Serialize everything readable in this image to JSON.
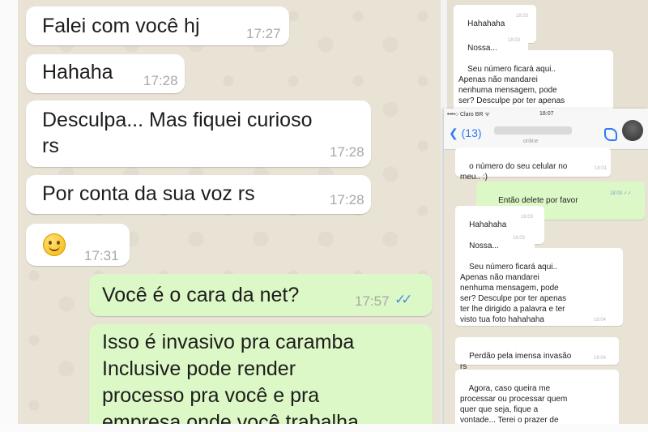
{
  "left_chat": {
    "messages": [
      {
        "dir": "in",
        "text": "Falei com você hj",
        "time": "17:27"
      },
      {
        "dir": "in",
        "text": "Hahaha",
        "time": "17:28"
      },
      {
        "dir": "in",
        "text": "Desculpa... Mas fiquei curioso\nrs",
        "time": "17:28"
      },
      {
        "dir": "in",
        "text": "Por conta da sua voz rs",
        "time": "17:28"
      },
      {
        "dir": "in",
        "emoji": "smiling-emoji",
        "time": "17:31"
      },
      {
        "dir": "out",
        "text": "Você é o cara da net?",
        "time": "17:57",
        "ticks": "✓✓"
      },
      {
        "dir": "out",
        "text": "Isso é invasivo pra caramba\nInclusive pode render\nprocesso pra você e pra\nempresa onde você trabalha"
      }
    ]
  },
  "right_back": {
    "messages": [
      {
        "text": "Hahahaha",
        "time": "18:03"
      },
      {
        "text": "Nossa...",
        "time": "18:03"
      },
      {
        "text": "Seu número ficará aqui..\nApenas não mandarei\nnenhuma mensagem, pode\nser? Desculpe por ter apenas"
      }
    ]
  },
  "right_front": {
    "status_bar": {
      "carrier": "••••○ Claro BR ᯤ",
      "time": "18:07"
    },
    "header": {
      "back_label": "❮ (13)",
      "online": "online"
    },
    "messages": [
      {
        "dir": "in",
        "text": "o número do seu celular no\nmeu.. :)",
        "time": "18:01"
      },
      {
        "dir": "out",
        "text": "Então delete por favor",
        "time": "18:03 ✓✓"
      },
      {
        "dir": "in",
        "text": "Hahahaha",
        "time": "18:03"
      },
      {
        "dir": "in",
        "text": "Nossa...",
        "time": "18:03"
      },
      {
        "dir": "in",
        "text": "Seu número ficará aqui..\nApenas não mandarei\nnenhuma mensagem, pode\nser? Desculpe por ter apenas\nter lhe dirigido a palavra e ter\nvisto tua foto hahahaha",
        "time": "18:04"
      },
      {
        "dir": "in",
        "text": "Perdão pela imensa invasão\nrs",
        "time": "18:04"
      },
      {
        "dir": "in",
        "text": "Agora, caso queira me\nprocessar ou processar quem\nquer que seja, fique a\nvontade... Terei o prazer de"
      }
    ]
  },
  "colors": {
    "incoming": "#ffffff",
    "outgoing": "#dcf8c6",
    "wallpaper": "#e9e3d6",
    "tick_blue": "#4a90e2"
  }
}
